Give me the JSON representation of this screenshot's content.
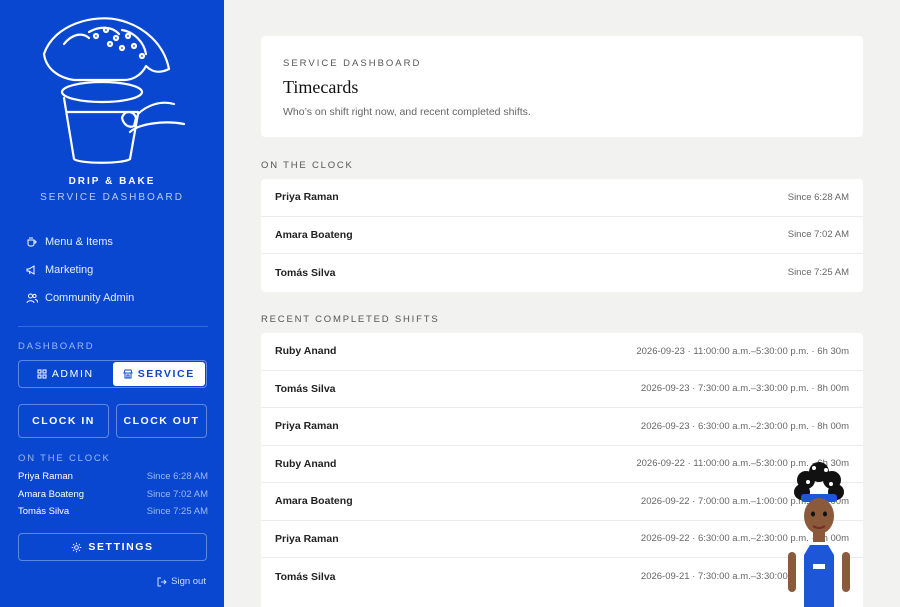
{
  "sidebar": {
    "brand": "DRIP & BAKE",
    "brand_sub": "SERVICE DASHBOARD",
    "nav": [
      {
        "label": "Menu & Items",
        "icon": "coffee-cup-icon"
      },
      {
        "label": "Marketing",
        "icon": "megaphone-icon"
      },
      {
        "label": "Community Admin",
        "icon": "users-icon"
      }
    ],
    "dashboard_label": "DASHBOARD",
    "toggle": {
      "admin": "ADMIN",
      "service": "SERVICE",
      "active": "service"
    },
    "clock_in": "CLOCK IN",
    "clock_out": "CLOCK OUT",
    "on_clock_label": "ON THE CLOCK",
    "on_clock": [
      {
        "name": "Priya Raman",
        "since": "Since 6:28 AM"
      },
      {
        "name": "Amara Boateng",
        "since": "Since 7:02 AM"
      },
      {
        "name": "Tomás Silva",
        "since": "Since 7:25 AM"
      }
    ],
    "settings": "SETTINGS",
    "signout": "Sign out"
  },
  "header": {
    "eyebrow": "SERVICE DASHBOARD",
    "title": "Timecards",
    "subtitle": "Who’s on shift right now, and recent completed shifts."
  },
  "on_clock_section": {
    "label": "ON THE CLOCK",
    "rows": [
      {
        "name": "Priya Raman",
        "meta": "Since 6:28 AM"
      },
      {
        "name": "Amara Boateng",
        "meta": "Since 7:02 AM"
      },
      {
        "name": "Tomás Silva",
        "meta": "Since 7:25 AM"
      }
    ]
  },
  "recent_section": {
    "label": "RECENT COMPLETED SHIFTS",
    "rows": [
      {
        "name": "Ruby Anand",
        "meta": "2026-09-23 · 11:00:00 a.m.–5:30:00 p.m. · 6h 30m"
      },
      {
        "name": "Tomás Silva",
        "meta": "2026-09-23 · 7:30:00 a.m.–3:30:00 p.m. · 8h 00m"
      },
      {
        "name": "Priya Raman",
        "meta": "2026-09-23 · 6:30:00 a.m.–2:30:00 p.m. · 8h 00m"
      },
      {
        "name": "Ruby Anand",
        "meta": "2026-09-22 · 11:00:00 a.m.–5:30:00 p.m. · 6h 30m"
      },
      {
        "name": "Amara Boateng",
        "meta": "2026-09-22 · 7:00:00 a.m.–1:00:00 p.m. · 6h 00m"
      },
      {
        "name": "Priya Raman",
        "meta": "2026-09-22 · 6:30:00 a.m.–2:30:00 p.m. · 8h 00m"
      },
      {
        "name": "Tomás Silva",
        "meta": "2026-09-21 · 7:30:00 a.m.–3:30:00 p.m. · 8h 00m"
      }
    ]
  },
  "colors": {
    "brand_blue": "#0a47d1",
    "background": "#f2f2f0",
    "card": "#ffffff"
  }
}
